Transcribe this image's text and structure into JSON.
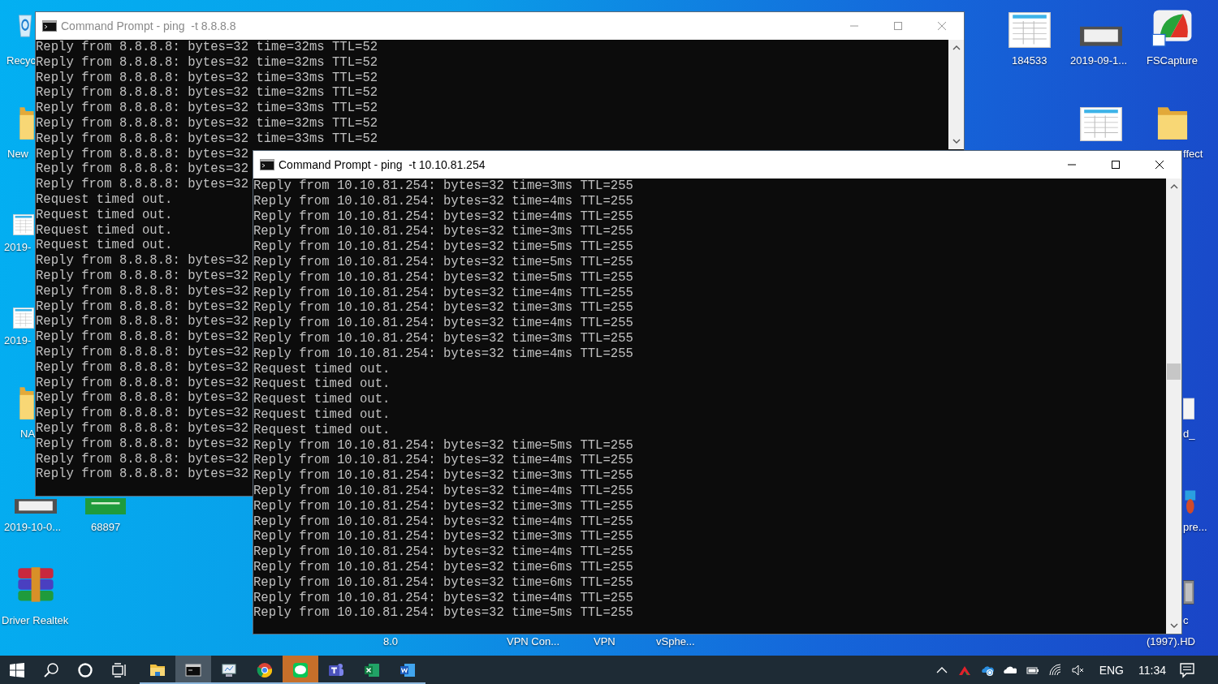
{
  "desktop_icons": [
    {
      "kind": "recycle-bin",
      "label": "Recyc"
    },
    {
      "kind": "folder",
      "label": "New"
    },
    {
      "kind": "spreadsheet",
      "label": "2019-"
    },
    {
      "kind": "spreadsheet",
      "label": "2019-"
    },
    {
      "kind": "folder",
      "label": "NA"
    },
    {
      "kind": "screenshot",
      "label": "2019-10-0..."
    },
    {
      "kind": "card",
      "label": "68897"
    },
    {
      "kind": "archive",
      "label": "Driver Realtek"
    },
    {
      "kind": "spreadsheet",
      "label": "184533"
    },
    {
      "kind": "screenshot",
      "label": "2019-09-1..."
    },
    {
      "kind": "capture-app",
      "label": "FSCapture"
    },
    {
      "kind": "spreadsheet"
    },
    {
      "kind": "folder",
      "label": "ffect"
    },
    {
      "kind": "document",
      "label": "d_"
    },
    {
      "kind": "presentation",
      "label": "pre..."
    },
    {
      "kind": "film",
      "label": "c"
    }
  ],
  "desktop_labels": [
    "8.0",
    "VPN Con...",
    "VPN",
    "vSphe...",
    "(1997).HD"
  ],
  "windows": [
    {
      "title": "Command Prompt - ping  -t 8.8.8.8",
      "active": false,
      "lines": [
        "Reply from 8.8.8.8: bytes=32 time=32ms TTL=52",
        "Reply from 8.8.8.8: bytes=32 time=32ms TTL=52",
        "Reply from 8.8.8.8: bytes=32 time=33ms TTL=52",
        "Reply from 8.8.8.8: bytes=32 time=32ms TTL=52",
        "Reply from 8.8.8.8: bytes=32 time=33ms TTL=52",
        "Reply from 8.8.8.8: bytes=32 time=32ms TTL=52",
        "Reply from 8.8.8.8: bytes=32 time=33ms TTL=52",
        "Reply from 8.8.8.8: bytes=32",
        "Reply from 8.8.8.8: bytes=32",
        "Reply from 8.8.8.8: bytes=32",
        "Request timed out.",
        "Request timed out.",
        "Request timed out.",
        "Request timed out.",
        "Reply from 8.8.8.8: bytes=32",
        "Reply from 8.8.8.8: bytes=32",
        "Reply from 8.8.8.8: bytes=32",
        "Reply from 8.8.8.8: bytes=32",
        "Reply from 8.8.8.8: bytes=32",
        "Reply from 8.8.8.8: bytes=32",
        "Reply from 8.8.8.8: bytes=32",
        "Reply from 8.8.8.8: bytes=32",
        "Reply from 8.8.8.8: bytes=32",
        "Reply from 8.8.8.8: bytes=32",
        "Reply from 8.8.8.8: bytes=32",
        "Reply from 8.8.8.8: bytes=32",
        "Reply from 8.8.8.8: bytes=32",
        "Reply from 8.8.8.8: bytes=32",
        "Reply from 8.8.8.8: bytes=32"
      ]
    },
    {
      "title": "Command Prompt - ping  -t 10.10.81.254",
      "active": true,
      "lines": [
        "Reply from 10.10.81.254: bytes=32 time=3ms TTL=255",
        "Reply from 10.10.81.254: bytes=32 time=4ms TTL=255",
        "Reply from 10.10.81.254: bytes=32 time=4ms TTL=255",
        "Reply from 10.10.81.254: bytes=32 time=3ms TTL=255",
        "Reply from 10.10.81.254: bytes=32 time=5ms TTL=255",
        "Reply from 10.10.81.254: bytes=32 time=5ms TTL=255",
        "Reply from 10.10.81.254: bytes=32 time=5ms TTL=255",
        "Reply from 10.10.81.254: bytes=32 time=4ms TTL=255",
        "Reply from 10.10.81.254: bytes=32 time=3ms TTL=255",
        "Reply from 10.10.81.254: bytes=32 time=4ms TTL=255",
        "Reply from 10.10.81.254: bytes=32 time=3ms TTL=255",
        "Reply from 10.10.81.254: bytes=32 time=4ms TTL=255",
        "Request timed out.",
        "Request timed out.",
        "Request timed out.",
        "Request timed out.",
        "Request timed out.",
        "Reply from 10.10.81.254: bytes=32 time=5ms TTL=255",
        "Reply from 10.10.81.254: bytes=32 time=4ms TTL=255",
        "Reply from 10.10.81.254: bytes=32 time=3ms TTL=255",
        "Reply from 10.10.81.254: bytes=32 time=4ms TTL=255",
        "Reply from 10.10.81.254: bytes=32 time=3ms TTL=255",
        "Reply from 10.10.81.254: bytes=32 time=4ms TTL=255",
        "Reply from 10.10.81.254: bytes=32 time=3ms TTL=255",
        "Reply from 10.10.81.254: bytes=32 time=4ms TTL=255",
        "Reply from 10.10.81.254: bytes=32 time=6ms TTL=255",
        "Reply from 10.10.81.254: bytes=32 time=6ms TTL=255",
        "Reply from 10.10.81.254: bytes=32 time=4ms TTL=255",
        "Reply from 10.10.81.254: bytes=32 time=5ms TTL=255"
      ]
    }
  ],
  "taskbar": {
    "buttons": [
      {
        "kind": "start"
      },
      {
        "kind": "search"
      },
      {
        "kind": "assistant"
      },
      {
        "kind": "task-view"
      }
    ],
    "apps": [
      {
        "kind": "folder",
        "running": true,
        "selected": false,
        "flashing": false
      },
      {
        "kind": "terminal",
        "running": true,
        "selected": true,
        "flashing": false
      },
      {
        "kind": "monitor",
        "running": true,
        "selected": false,
        "flashing": false
      },
      {
        "kind": "browser",
        "running": true,
        "selected": false,
        "flashing": false
      },
      {
        "kind": "chat",
        "running": true,
        "selected": false,
        "flashing": true
      },
      {
        "kind": "team-chat",
        "running": true,
        "selected": false,
        "flashing": false
      },
      {
        "kind": "spreadsheet",
        "running": true,
        "selected": false,
        "flashing": false
      },
      {
        "kind": "document",
        "running": true,
        "selected": false,
        "flashing": false
      }
    ],
    "tray": [
      {
        "kind": "chevron"
      },
      {
        "kind": "red-arrow"
      },
      {
        "kind": "cloud-sync"
      },
      {
        "kind": "cloud"
      },
      {
        "kind": "battery"
      },
      {
        "kind": "wifi"
      },
      {
        "kind": "speaker-muted"
      }
    ],
    "language": "ENG",
    "time": "11:34"
  }
}
